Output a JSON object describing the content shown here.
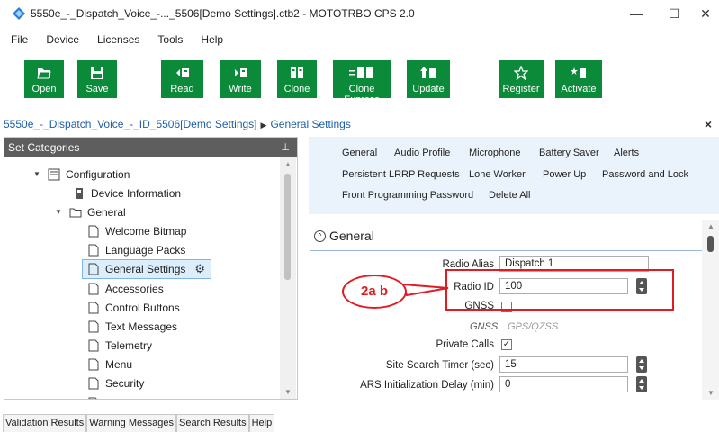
{
  "window": {
    "title": "5550e_-_Dispatch_Voice_-..._5506[Demo Settings].ctb2 - MOTOTRBO CPS 2.0",
    "minimize": "—",
    "maximize": "☐",
    "close": "✕"
  },
  "menu": [
    "File",
    "Device",
    "Licenses",
    "Tools",
    "Help"
  ],
  "toolbar": {
    "accent": "#0b8a3a",
    "buttons": [
      {
        "label": "Open",
        "icon": "folder-icon"
      },
      {
        "label": "Save",
        "icon": "save-icon"
      },
      {
        "label": "Read",
        "icon": "read-icon"
      },
      {
        "label": "Write",
        "icon": "write-icon"
      },
      {
        "label": "Clone",
        "icon": "clone-icon"
      },
      {
        "label": "Clone Express",
        "icon": "clone-express-icon"
      },
      {
        "label": "Update",
        "icon": "update-icon"
      },
      {
        "label": "Register",
        "icon": "star-icon"
      },
      {
        "label": "Activate",
        "icon": "activate-icon"
      }
    ]
  },
  "breadcrumb": {
    "file": "5550e_-_Dispatch_Voice_-_ID_5506[Demo Settings]",
    "section": "General Settings",
    "close": "×"
  },
  "left_panel": {
    "title": "Set Categories",
    "pin": "📌",
    "tree": [
      {
        "label": "Configuration",
        "icon": "configuration-icon",
        "expanded": true
      },
      {
        "label": "Device Information",
        "icon": "device-icon"
      },
      {
        "label": "General",
        "icon": "folder-outline-icon",
        "expanded": true
      },
      {
        "label": "Welcome Bitmap",
        "icon": "page-icon"
      },
      {
        "label": "Language Packs",
        "icon": "page-icon"
      },
      {
        "label": "General Settings",
        "icon": "page-icon",
        "selected": true
      },
      {
        "label": "Accessories",
        "icon": "page-icon"
      },
      {
        "label": "Control Buttons",
        "icon": "page-icon"
      },
      {
        "label": "Text Messages",
        "icon": "page-icon"
      },
      {
        "label": "Telemetry",
        "icon": "page-icon"
      },
      {
        "label": "Menu",
        "icon": "page-icon"
      },
      {
        "label": "Security",
        "icon": "page-icon"
      }
    ]
  },
  "tabs": [
    "General",
    "Audio Profile",
    "Microphone",
    "Battery Saver",
    "Alerts",
    "Persistent LRRP Requests",
    "Lone Worker",
    "Power Up",
    "Password and Lock",
    "Front Programming Password",
    "Delete All"
  ],
  "section": {
    "title": "General",
    "fields": {
      "radio_alias": {
        "label": "Radio Alias",
        "value": "Dispatch 1"
      },
      "radio_id": {
        "label": "Radio ID",
        "value": "100"
      },
      "gnss": {
        "label": "GNSS",
        "checked": false
      },
      "gnss_type": {
        "label": "GNSS",
        "value": "GPS/QZSS"
      },
      "private_calls": {
        "label": "Private Calls",
        "checked": true
      },
      "site_search_timer": {
        "label": "Site Search Timer (sec)",
        "value": "15"
      },
      "ars_init_delay": {
        "label": "ARS Initialization Delay (min)",
        "value": "0"
      }
    }
  },
  "annotation": {
    "label": "2a b",
    "color": "#e11b22"
  },
  "bottom_tabs": [
    "Validation Results",
    "Warning Messages",
    "Search Results",
    "Help"
  ]
}
